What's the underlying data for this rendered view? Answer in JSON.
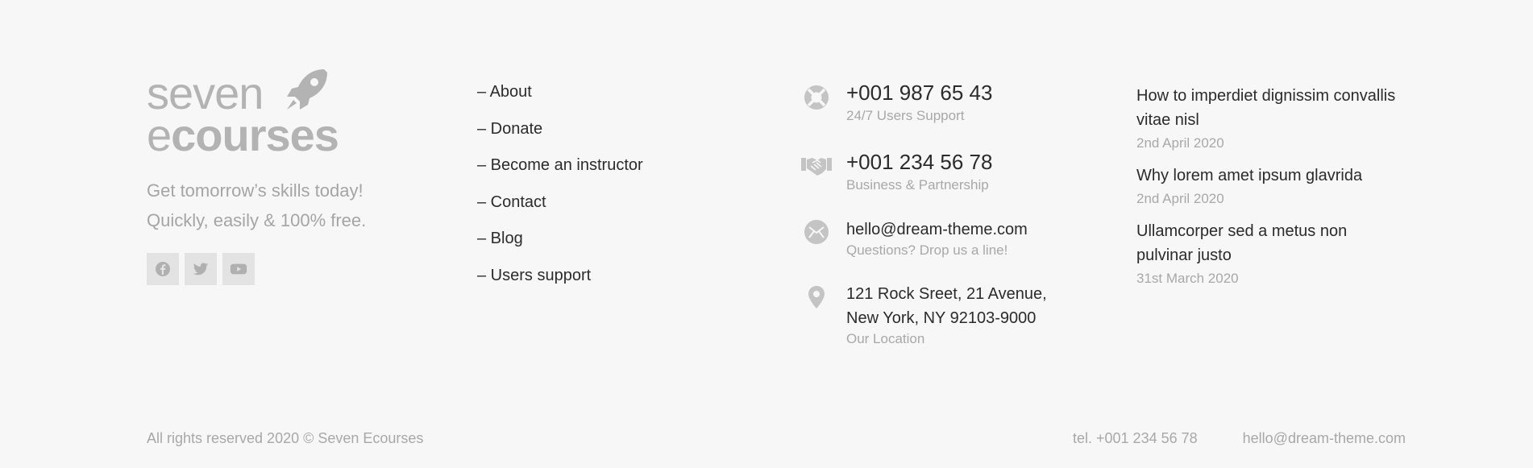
{
  "brand": {
    "logo_line1": "seven",
    "logo_e": "e",
    "logo_line2": "courses",
    "tagline_line1": "Get tomorrow’s skills today!",
    "tagline_line2": "Quickly, easily & 100% free.",
    "social": [
      "facebook-icon",
      "twitter-icon",
      "youtube-icon"
    ]
  },
  "links": [
    "– About",
    "– Donate",
    "– Become an instructor",
    "– Contact",
    "– Blog",
    "– Users support"
  ],
  "contacts": {
    "support": {
      "icon": "lifebuoy-icon",
      "value": "+001 987 65 43",
      "label": "24/7 Users Support"
    },
    "business": {
      "icon": "handshake-icon",
      "value": "+001 234 56 78",
      "label": "Business & Partnership"
    },
    "email": {
      "icon": "envelope-icon",
      "value": "hello@dream-theme.com",
      "label": "Questions? Drop us a line!"
    },
    "location": {
      "icon": "map-pin-icon",
      "line1": "121 Rock Sreet, 21 Avenue,",
      "line2": "New York, NY 92103-9000",
      "label": "Our Location"
    }
  },
  "posts": [
    {
      "title_line1": "How to imperdiet dignissim convallis",
      "title_line2": "vitae nisl",
      "date": "2nd April 2020"
    },
    {
      "title_line1": "Why lorem amet ipsum glavrida",
      "date": "2nd April 2020"
    },
    {
      "title_line1": "Ullamcorper sed a metus non",
      "title_line2": "pulvinar justo",
      "date": "31st March 2020"
    }
  ],
  "bottom": {
    "copyright": "All rights reserved 2020 © Seven Ecourses",
    "tel": "tel. +001 234 56 78",
    "email": "hello@dream-theme.com"
  },
  "colors": {
    "background": "#f7f7f7",
    "text": "#2b2b2b",
    "muted": "#a8a8a8",
    "icon": "#c4c4c4",
    "social_bg": "#e3e3e3"
  }
}
